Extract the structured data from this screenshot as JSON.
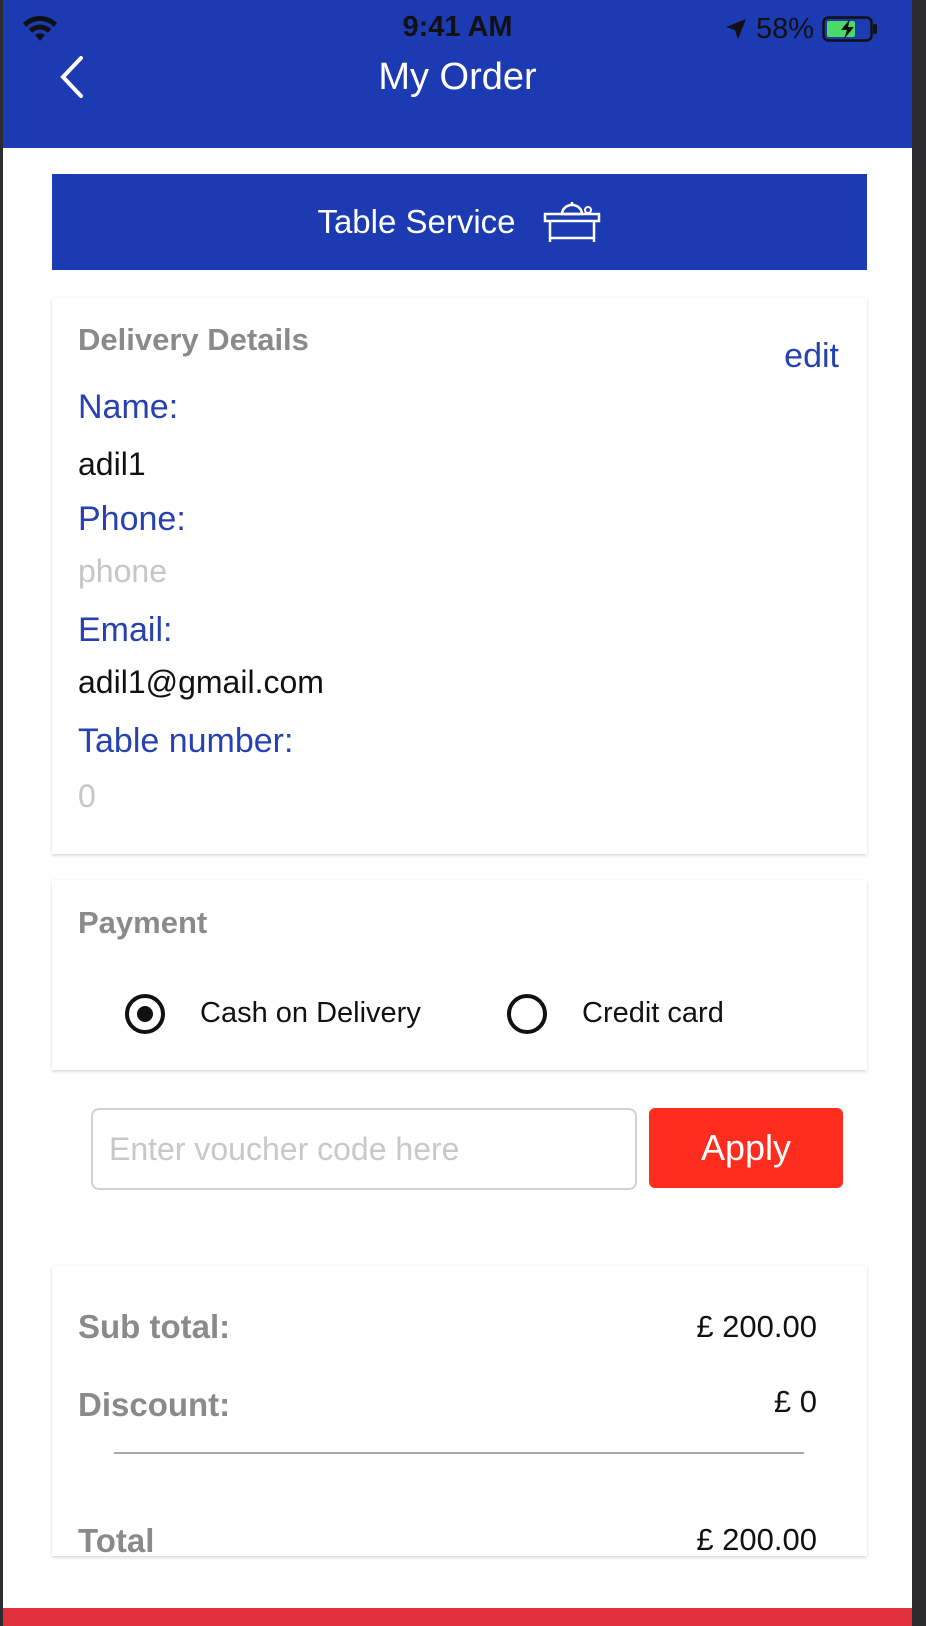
{
  "status_bar": {
    "time": "9:41 AM",
    "battery": "58%",
    "icons": [
      "wifi-icon",
      "location-icon",
      "battery-charging-icon"
    ]
  },
  "header": {
    "title": "My Order",
    "back_icon": "chevron-left-icon",
    "color": "#1c3bb3"
  },
  "service": {
    "label": "Table Service",
    "icon": "table-service-icon"
  },
  "delivery": {
    "title": "Delivery Details",
    "edit": "edit",
    "name_label": "Name:",
    "name_value": "adil1",
    "phone_label": "Phone:",
    "phone_value": "phone",
    "email_label": "Email:",
    "email_value": "adil1@gmail.com",
    "table_label": "Table number:",
    "table_value": "0"
  },
  "payment": {
    "title": "Payment",
    "options": [
      {
        "label": "Cash on Delivery",
        "selected": true
      },
      {
        "label": "Credit card",
        "selected": false
      }
    ]
  },
  "voucher": {
    "placeholder": "Enter voucher code here",
    "apply": "Apply",
    "apply_color": "#ff2d1e"
  },
  "summary": {
    "subtotal_label": "Sub total:",
    "subtotal_value": "£  200.00",
    "discount_label": "Discount:",
    "discount_value": "£  0",
    "total_label": "Total",
    "total_value": "£  200.00"
  }
}
